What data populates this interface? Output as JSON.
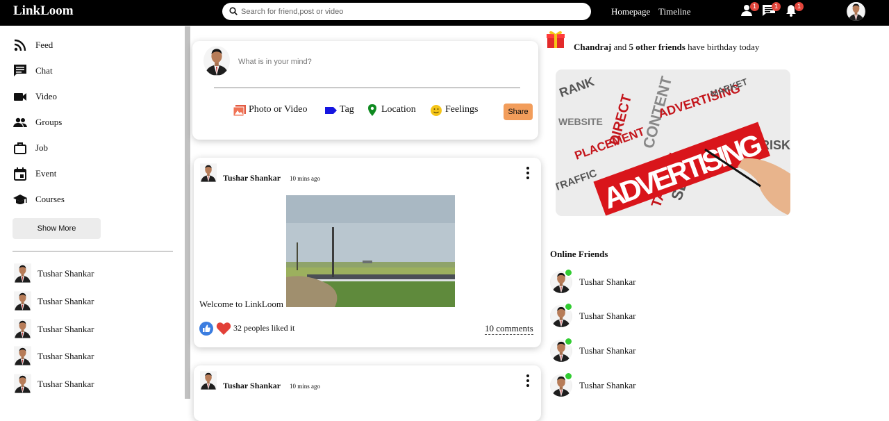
{
  "header": {
    "logo": "LinkLoom",
    "search_placeholder": "Search for friend,post or video",
    "links": [
      "Homepage",
      "Timeline"
    ],
    "badges": {
      "friends": "1",
      "messages": "1",
      "notifications": "1"
    }
  },
  "sidebar": {
    "items": [
      {
        "label": "Feed",
        "icon": "rss-icon"
      },
      {
        "label": "Chat",
        "icon": "chat-icon"
      },
      {
        "label": "Video",
        "icon": "video-icon"
      },
      {
        "label": "Groups",
        "icon": "groups-icon"
      },
      {
        "label": "Job",
        "icon": "briefcase-icon"
      },
      {
        "label": "Event",
        "icon": "calendar-icon"
      },
      {
        "label": "Courses",
        "icon": "school-icon"
      }
    ],
    "show_more": "Show More",
    "friends": [
      "Tushar Shankar",
      "Tushar Shankar",
      "Tushar Shankar",
      "Tushar Shankar",
      "Tushar Shankar"
    ]
  },
  "share": {
    "placeholder": "What is in your mind?",
    "options": [
      "Photo or Video",
      "Tag",
      "Location",
      "Feelings"
    ],
    "button": "Share"
  },
  "posts": [
    {
      "user": "Tushar Shankar",
      "time": "10 mins ago",
      "text": "Welcome to LinkLoom",
      "likes": "32 peoples liked it",
      "comments": "10 comments"
    },
    {
      "user": "Tushar Shankar",
      "time": "10 mins ago"
    }
  ],
  "rightbar": {
    "birthday": {
      "name": "Chandraj",
      "middle": " and ",
      "others": "5 other friends",
      "suffix": " have birthday today"
    },
    "ad_words": [
      "ADVERTISING",
      "ADVERTISING",
      "SEO",
      "TARGET",
      "PLACEMENT",
      "DIRECT",
      "CONTENT",
      "MARKET",
      "RANK",
      "WEBSITE",
      "RISK",
      "TRAFFIC"
    ],
    "online_title": "Online Friends",
    "online_friends": [
      "Tushar Shankar",
      "Tushar Shankar",
      "Tushar Shankar",
      "Tushar Shankar"
    ]
  },
  "colors": {
    "topbar": "#000000",
    "badge": "#e2453b",
    "share_button": "#f29d5b",
    "online_dot": "#32cd32",
    "ad_red": "#d9151b"
  }
}
